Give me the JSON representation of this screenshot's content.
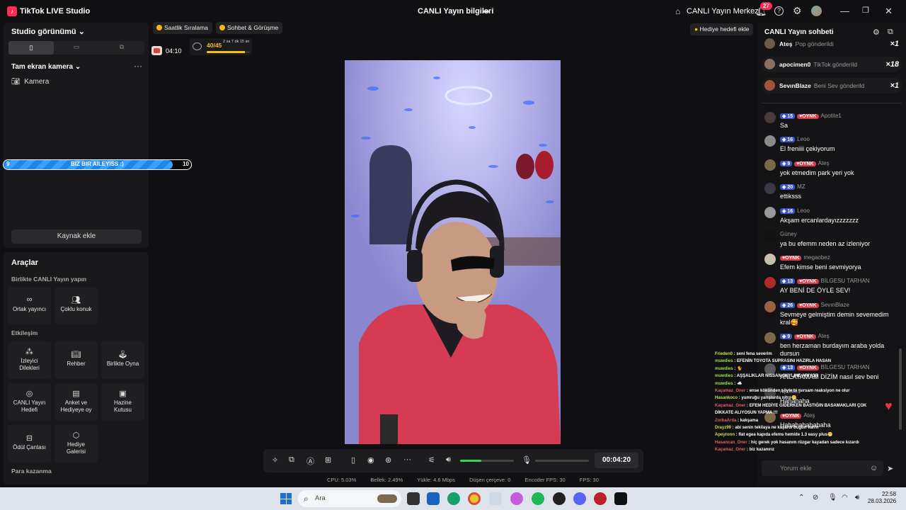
{
  "titlebar": {
    "app_name": "TikTok LIVE Studio",
    "center_title": "CANLI Yayın bilgileri",
    "center_right": "CANLI Yayın Merkezi",
    "notif_count": "27"
  },
  "left": {
    "studio_view": "Studio görünümü",
    "scene_name": "Tam ekran kamera",
    "source_camera": "Kamera",
    "add_source": "Kaynak ekle"
  },
  "goal_bar": {
    "label": "BIZ BIR AILEYISS :)",
    "left": "9",
    "right": "10",
    "progress": 0.9
  },
  "tools": {
    "title": "Araçlar",
    "section1": "Birlikte CANLI Yayın yapın",
    "cohost": "Ortak yayıncı",
    "multiguest": "Çoklu konuk",
    "section2": "Etkileşim",
    "viewer_requests": "İzleyici Dilekleri",
    "guide": "Rehber",
    "play_together": "Birlikte Oyna",
    "live_goal": "CANLI Yayın Hedefi",
    "poll": "Anket ve Hediyeye oy",
    "treasure": "Hazine Kutusu",
    "reward_bag": "Ödül Çantası",
    "gift_gallery": "Hediye Galerisi",
    "section3": "Para kazanma"
  },
  "top_chips": {
    "hourly": "Saatlik Sıralama",
    "chat_meet": "Sohbet & Görüşme",
    "gift_timer": "04:10",
    "level": "40/45",
    "level_time": "2 sa 7 dk 15 sn",
    "level_progress": 0.89,
    "gift_goal": "Hediye hedefi ekle"
  },
  "controls": {
    "timer": "00:04:20",
    "volume_level": 0.4
  },
  "stats": {
    "cpu": "CPU:  5.03%",
    "mem": "Bellek:  2.49%",
    "upload": "Yükle:  4.6 Mbps",
    "drop": "Düşen çerçeve:  0",
    "encoder": "Encoder FPS:  30",
    "fps": "FPS:  30"
  },
  "chat": {
    "title": "CANLI Yayın sohbeti",
    "gifts": [
      {
        "name": "Ateş",
        "text": "Pop gönderildi",
        "count": "×1"
      },
      {
        "name": "apocimen0",
        "text": "TikTok gönderild",
        "count": "×18"
      },
      {
        "name": "SevınBlaze",
        "text": "Beni Sev gönderild",
        "count": "×1"
      }
    ],
    "messages": [
      {
        "lvl": "15",
        "fan": "OYNK",
        "user": "Apotite1",
        "text": "Sa"
      },
      {
        "lvl": "16",
        "fan": "",
        "user": "Leoo",
        "text": "El freniiii çekiyorum"
      },
      {
        "lvl": "9",
        "fan": "OYNK",
        "user": "Ateş",
        "text": "yok etmedim park yeri yok"
      },
      {
        "lvl": "20",
        "fan": "",
        "user": "MZ",
        "text": "ettiksss"
      },
      {
        "lvl": "16",
        "fan": "",
        "user": "Leoo",
        "text": "Akşam ercanlardayızzzzzzz"
      },
      {
        "lvl": "",
        "fan": "",
        "user": "Güney",
        "text": "ya bu efemm neden az izleniyor"
      },
      {
        "lvl": "",
        "fan": "OYNK",
        "user": "megaobez",
        "text": "Efem kimse beni sevmiyorya"
      },
      {
        "lvl": "13",
        "fan": "OYNK",
        "user": "BİLGESU TARHAN",
        "text": "AY BENİ DE ÖYLE SEV!"
      },
      {
        "lvl": "26",
        "fan": "OYNK",
        "user": "SevınBlaze",
        "text": "Sevmeye gelmiştim demin sevemedim kral🥰"
      },
      {
        "lvl": "9",
        "fan": "OYNK",
        "user": "Ateş",
        "text": "ben herzaman burdayım araba yolda dursun"
      },
      {
        "lvl": "13",
        "fan": "OYNK",
        "user": "BİLGESU TARHAN",
        "text": "ANLATAMAM DİZİM nasıl sev beni"
      },
      {
        "lvl": "",
        "fan": "",
        "user": "Apotite1",
        "text": "Hahahaha"
      },
      {
        "lvl": "",
        "fan": "OYNK",
        "user": "Ateş",
        "text": "Hahahahahahaha"
      }
    ],
    "input_placeholder": "Yorum ekle"
  },
  "overlay_chat": [
    {
      "user": "Frieden0",
      "text": ": seni fena severim"
    },
    {
      "user": "muwdies",
      "text": ": EFENİN TOYOTA SUPRASINI HAZIRLA HASAN"
    },
    {
      "user": "muwdies",
      "text": ": 🐈"
    },
    {
      "user": "muwdies",
      "text": ": AŞŞALIKLAR NISSAN SKYLINE ARIYOR"
    },
    {
      "user": "muwdies",
      "text": ": ☁️"
    },
    {
      "user": "Kaçamaz_Oner",
      "text": ": ense kökünden şöyle bi ısırsam reaksiyon ne olur"
    },
    {
      "user": "Hasankoco",
      "text": ": yumruğu yarışlarda nitro😁"
    },
    {
      "user": "Kaçamaz_Oner",
      "text": ": EFEM HEDİYE GİDERKEN BASTIĞIN BASAMAKLARI ÇOK"
    },
    {
      "user": "",
      "text": "DİKKATE ALIYOSUN YAPMA !!!"
    },
    {
      "user": "ZorbaArda",
      "text": ": kakşama"
    },
    {
      "user": "Drayz99",
      "text": ": abi senin tekilaya ne kaşardı bugün varrrr"
    },
    {
      "user": "Apeyronn",
      "text": ": flat egea kapıda efems hemide 1.3 easy plus😁"
    },
    {
      "user": "Hasancan_Oner",
      "text": ": hiç gerek yok hasanım rüzgar kayadan sadece kızardı"
    },
    {
      "user": "Kaçamaz_Oner",
      "text": ": biz kazanırız"
    }
  ],
  "taskbar": {
    "search": "Ara",
    "time": "22:58",
    "date": "28.03.2026"
  },
  "colors": {
    "accent_blue": "#1e86e8",
    "tiktok_red": "#ff2b55",
    "green": "#2bd85a"
  }
}
